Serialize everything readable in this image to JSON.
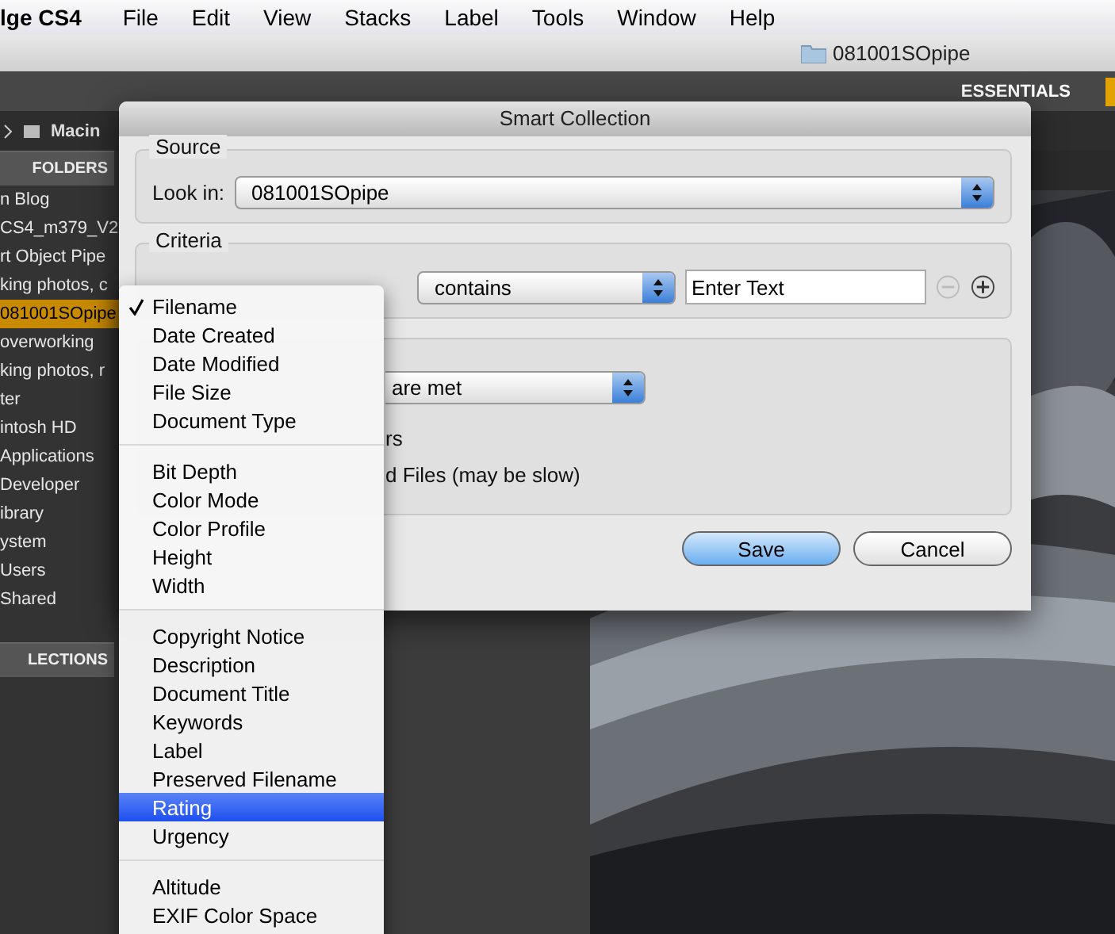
{
  "menu_bar": {
    "app": "lge CS4",
    "items": [
      "File",
      "Edit",
      "View",
      "Stacks",
      "Label",
      "Tools",
      "Window",
      "Help"
    ]
  },
  "path_bar": {
    "folder": "081001SOpipe"
  },
  "toolbar": {
    "workspace": "ESSENTIALS"
  },
  "breadcrumb": {
    "item": "Macin"
  },
  "folders_panel": {
    "tab": "FOLDERS",
    "items": [
      {
        "label": "n Blog",
        "selected": false
      },
      {
        "label": "CS4_m379_V2",
        "selected": false
      },
      {
        "label": "rt Object Pipe",
        "selected": false
      },
      {
        "label": "king photos, c",
        "selected": false
      },
      {
        "label": "081001SOpipe",
        "selected": true
      },
      {
        "label": "overworking",
        "selected": false
      },
      {
        "label": "king photos, r",
        "selected": false
      },
      {
        "label": "ter",
        "selected": false
      },
      {
        "label": "intosh HD",
        "selected": false
      },
      {
        "label": "Applications",
        "selected": false
      },
      {
        "label": "Developer",
        "selected": false
      },
      {
        "label": "ibrary",
        "selected": false
      },
      {
        "label": "ystem",
        "selected": false
      },
      {
        "label": "Users",
        "selected": false
      },
      {
        "label": "Shared",
        "selected": false
      }
    ],
    "collections_tab": "LECTIONS"
  },
  "dialog": {
    "title": "Smart Collection",
    "source": {
      "legend": "Source",
      "look_in_label": "Look in:",
      "look_in_value": "081001SOpipe"
    },
    "criteria": {
      "legend": "Criteria",
      "operator": "contains",
      "placeholder": "Enter Text"
    },
    "results": {
      "match_value": "are met",
      "option_1": "rs",
      "option_2": "d Files (may be slow)"
    },
    "buttons": [
      {
        "label": "Save",
        "default": true
      },
      {
        "label": "Cancel",
        "default": false
      }
    ]
  },
  "field_menu": {
    "groups": [
      [
        {
          "label": "Filename",
          "checked": true,
          "selected": false
        },
        {
          "label": "Date Created",
          "checked": false,
          "selected": false
        },
        {
          "label": "Date Modified",
          "checked": false,
          "selected": false
        },
        {
          "label": "File Size",
          "checked": false,
          "selected": false
        },
        {
          "label": "Document Type",
          "checked": false,
          "selected": false
        }
      ],
      [
        {
          "label": "Bit Depth",
          "checked": false,
          "selected": false
        },
        {
          "label": "Color Mode",
          "checked": false,
          "selected": false
        },
        {
          "label": "Color Profile",
          "checked": false,
          "selected": false
        },
        {
          "label": "Height",
          "checked": false,
          "selected": false
        },
        {
          "label": "Width",
          "checked": false,
          "selected": false
        }
      ],
      [
        {
          "label": "Copyright Notice",
          "checked": false,
          "selected": false
        },
        {
          "label": "Description",
          "checked": false,
          "selected": false
        },
        {
          "label": "Document Title",
          "checked": false,
          "selected": false
        },
        {
          "label": "Keywords",
          "checked": false,
          "selected": false
        },
        {
          "label": "Label",
          "checked": false,
          "selected": false
        },
        {
          "label": "Preserved Filename",
          "checked": false,
          "selected": false
        },
        {
          "label": "Rating",
          "checked": false,
          "selected": true
        },
        {
          "label": "Urgency",
          "checked": false,
          "selected": false
        }
      ],
      [
        {
          "label": "Altitude",
          "checked": false,
          "selected": false
        },
        {
          "label": "EXIF Color Space",
          "checked": false,
          "selected": false
        }
      ]
    ]
  }
}
